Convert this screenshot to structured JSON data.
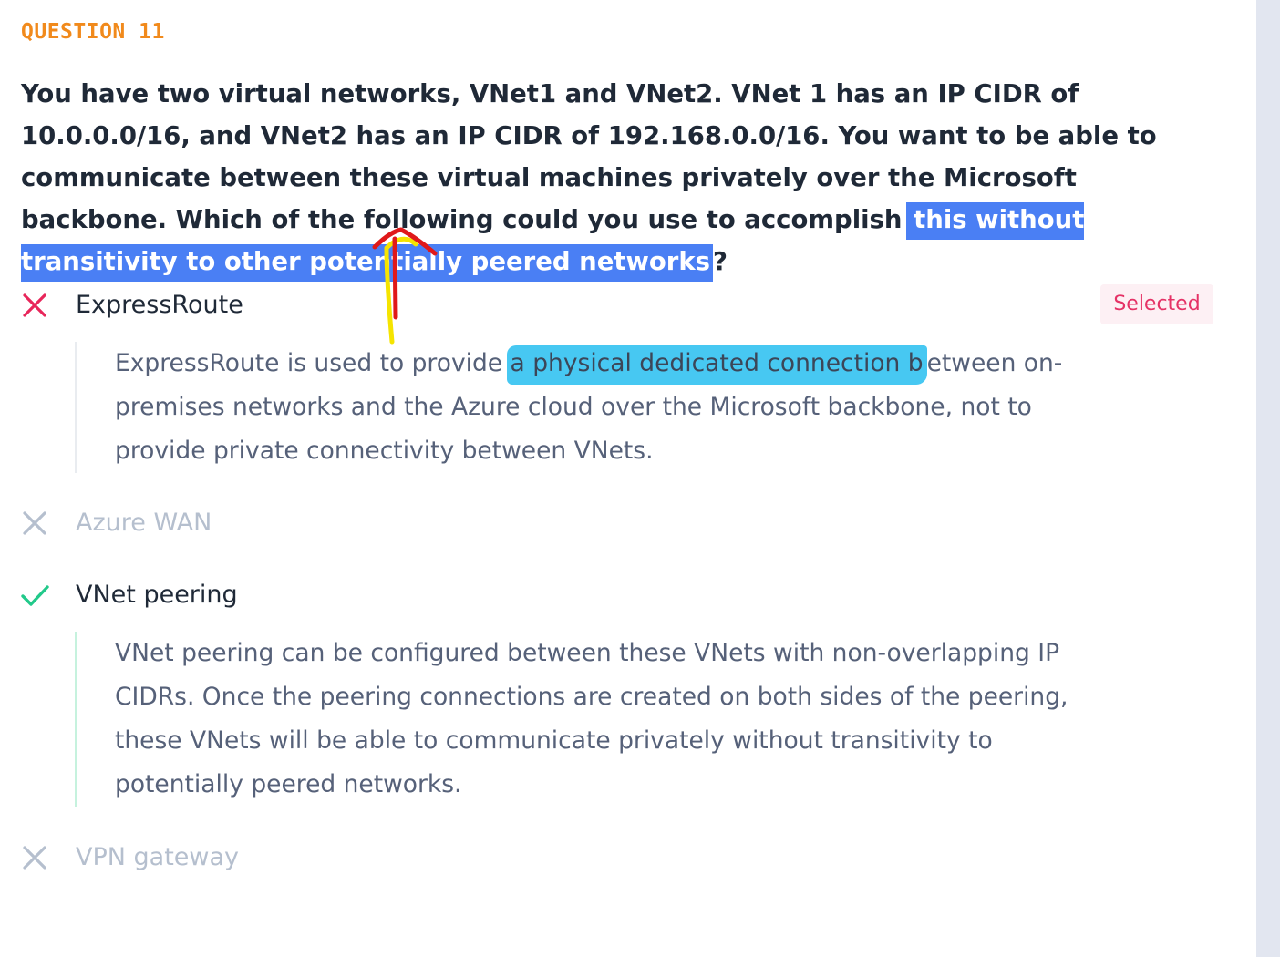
{
  "question": {
    "label": "QUESTION 11",
    "text_before": "You have two virtual networks, VNet1 and VNet2. VNet 1 has an IP CIDR of 10.0.0.0/16, and VNet2 has an IP CIDR of 192.168.0.0/16. You want to be able to communicate between these virtual machines privately over the Microsoft backbone. Which of the following could you use to accomplish",
    "text_highlighted": "this without transitivity to other potentially peered networks",
    "text_after": "?"
  },
  "options": [
    {
      "label": "ExpressRoute",
      "status": "incorrect",
      "icon": "x-icon",
      "badge": "Selected",
      "explanation_before": "ExpressRoute is used to provide ",
      "explanation_highlighted": "a physical dedicated connection b",
      "explanation_after": "etween on-premises networks and the Azure cloud over the Microsoft backbone, not to provide private connectivity between VNets."
    },
    {
      "label": "Azure WAN",
      "status": "not-selected",
      "icon": "x-icon"
    },
    {
      "label": "VNet peering",
      "status": "correct",
      "icon": "check-icon",
      "explanation": "VNet peering can be configured between these VNets with non-overlapping IP CIDRs. Once the peering connections are created on both sides of the peering, these VNets will be able to communicate privately without transitivity to potentially peered networks."
    },
    {
      "label": "VPN gateway",
      "status": "not-selected",
      "icon": "x-icon"
    }
  ],
  "colors": {
    "question_label": "#f18a1c",
    "text_highlight": "#4a7ff4",
    "marker_highlight": "#2ec0f0",
    "incorrect": "#e8265a",
    "correct": "#22c98a",
    "muted": "#b5bfce",
    "badge_text": "#e53266",
    "badge_bg": "#fdf0f4",
    "annotation_red": "#e0191a",
    "annotation_yellow": "#f5e400"
  }
}
